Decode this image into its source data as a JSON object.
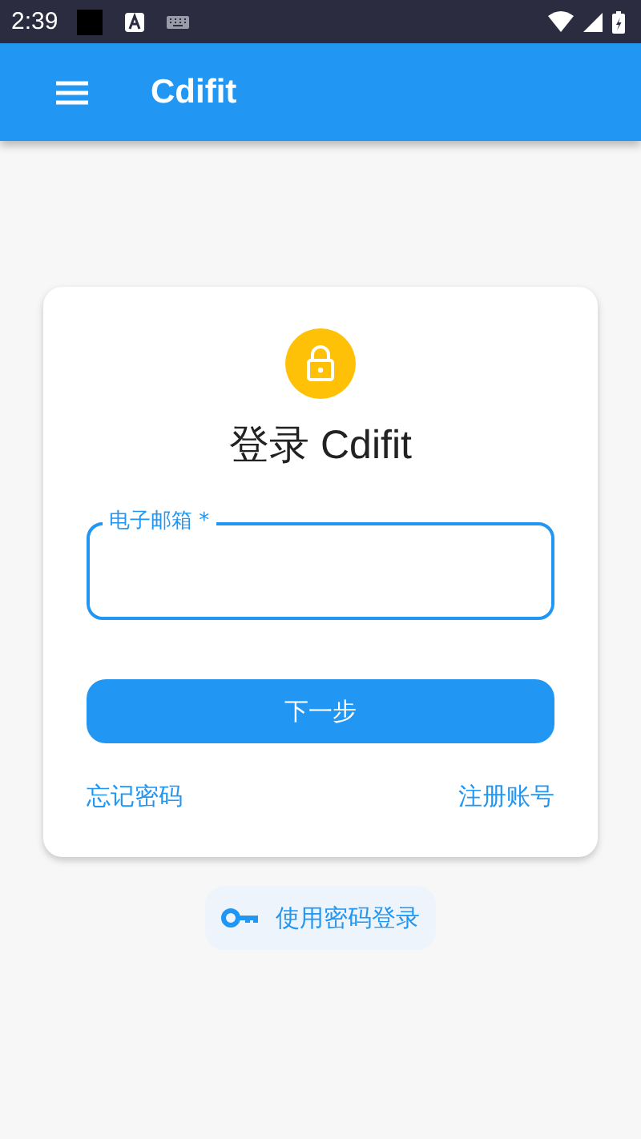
{
  "status_bar": {
    "time": "2:39"
  },
  "app_bar": {
    "title": "Cdifit"
  },
  "login_card": {
    "title": "登录 Cdifit",
    "email_field": {
      "label": "电子邮箱 *"
    },
    "next_button": "下一步",
    "forgot_link": "忘记密码",
    "register_link": "注册账号"
  },
  "password_login_button": "使用密码登录"
}
